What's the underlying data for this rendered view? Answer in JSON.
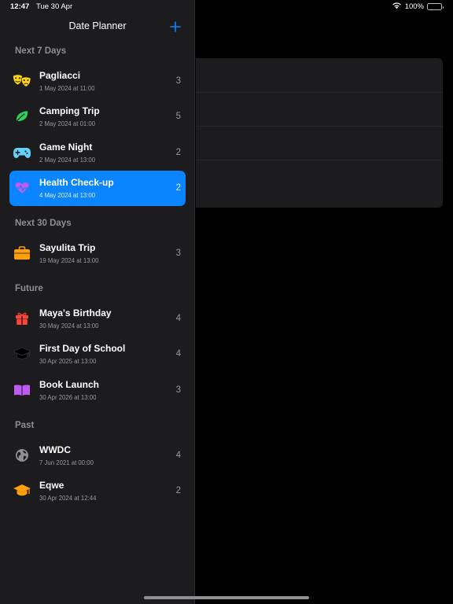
{
  "status": {
    "time": "12:47",
    "date": "Tue 30 Apr",
    "battery": "100%"
  },
  "nav": {
    "title": "Date Planner"
  },
  "sections": {
    "next7": "Next 7 Days",
    "next30": "Next 30 Days",
    "future": "Future",
    "past": "Past"
  },
  "events": [
    {
      "name": "Pagliacci",
      "when": "1 May 2024 at 11:00",
      "count": "3",
      "icon": "theater-masks-icon",
      "color": "#ffd60a"
    },
    {
      "name": "Camping Trip",
      "when": "2 May 2024 at 01:00",
      "count": "5",
      "icon": "leaf-icon",
      "color": "#30d158"
    },
    {
      "name": "Game Night",
      "when": "2 May 2024 at 13:00",
      "count": "2",
      "icon": "game-controller-icon",
      "color": "#64d2ff"
    },
    {
      "name": "Health Check-up",
      "when": "4 May 2024 at 13:00",
      "count": "2",
      "icon": "heart-icon",
      "color": "#bf5af2"
    },
    {
      "name": "Sayulita Trip",
      "when": "19 May 2024 at 13:00",
      "count": "3",
      "icon": "suitcase-icon",
      "color": "#ff9f0a"
    },
    {
      "name": "Maya's Birthday",
      "when": "30 May 2024 at 13:00",
      "count": "4",
      "icon": "gift-icon",
      "color": "#ff453a"
    },
    {
      "name": "First Day of School",
      "when": "30 Apr 2025 at 13:00",
      "count": "4",
      "icon": "graduation-cap-icon",
      "color": "#000000"
    },
    {
      "name": "Book Launch",
      "when": "30 Apr 2026 at 13:00",
      "count": "3",
      "icon": "book-icon",
      "color": "#bf5af2"
    },
    {
      "name": "WWDC",
      "when": "7 Jun 2021 at 00:00",
      "count": "4",
      "icon": "globe-icon",
      "color": "#8e8e93"
    },
    {
      "name": "Eqwe",
      "when": "30 Apr 2024 at 12:44",
      "count": "2",
      "icon": "graduation-cap-icon",
      "color": "#ff9f0a"
    }
  ],
  "selected_event": "Health Check-up",
  "colors": {
    "accent": "#0a84ff",
    "sidebar_bg": "#1c1c1e",
    "background": "#000000"
  }
}
